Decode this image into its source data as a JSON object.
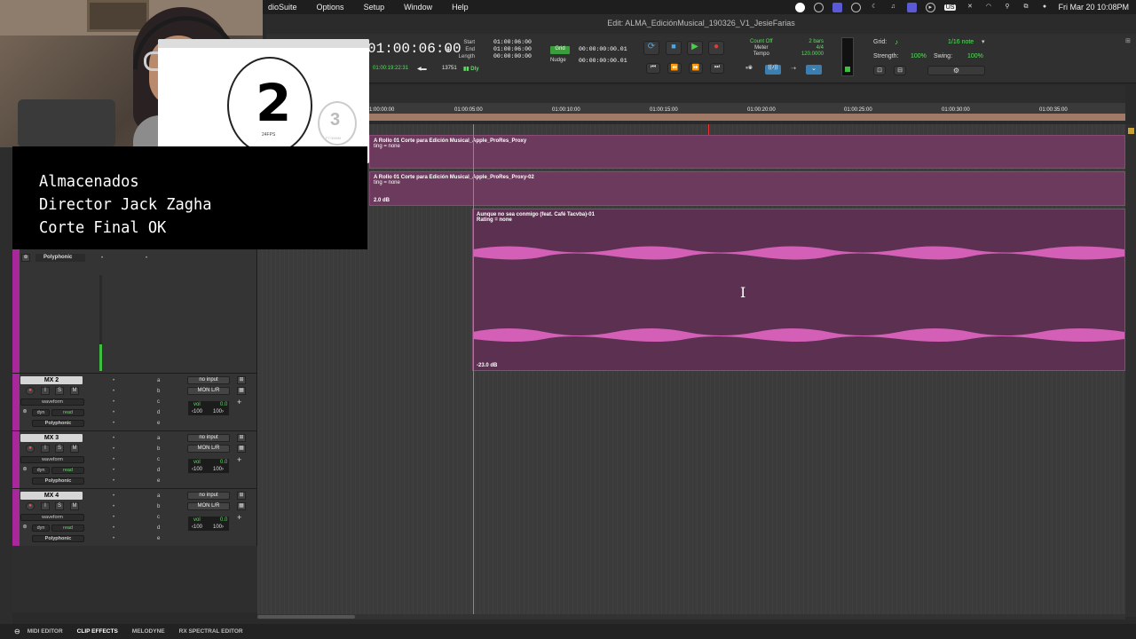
{
  "menu": {
    "app": "dioSuite",
    "items": [
      "Options",
      "Setup",
      "Window",
      "Help"
    ],
    "clock": "Fri Mar 20  10:08PM",
    "keyboard": "US"
  },
  "window": {
    "title": "Edit: ALMA_EdiciónMusical_190326_V1_JesieFarias"
  },
  "counter": {
    "main": "01:00:06:00",
    "sub": "01:00:19:22:31",
    "samples": "13751",
    "dly": "Dly"
  },
  "selection": {
    "start_label": "Start",
    "end_label": "End",
    "length_label": "Length",
    "start": "01:00:06:00",
    "end": "01:00:06:00",
    "length": "00:00:00:00"
  },
  "grid_nudge": {
    "grid_label": "Grid",
    "nudge_label": "Nudge",
    "grid_val": "00:00:00:00.01",
    "nudge_val": "00:00:00:00.01"
  },
  "count": {
    "count_off": "Count Off",
    "meter": "Meter",
    "tempo": "Tempo",
    "bars": "2 bars",
    "sig": "4/4",
    "bpm": "120.0000"
  },
  "gridpanel": {
    "grid_label": "Grid:",
    "grid_val": "1/16 note",
    "strength_label": "Strength:",
    "strength_val": "100%",
    "swing_label": "Swing:",
    "swing_val": "100%"
  },
  "ruler": {
    "ticks": [
      "1:00:00:00",
      "01:00:05:00",
      "01:00:10:00",
      "01:00:15:00",
      "01:00:20:00",
      "01:00:25:00",
      "01:00:30:00",
      "01:00:35:00"
    ]
  },
  "clips": {
    "video1_name": "A Rollo 01 Corte para Edición Musical_Apple_ProRes_Proxy",
    "video1_rating": "ting = none",
    "video2_name": "A Rollo 01 Corte para Edición Musical_Apple_ProRes_Proxy-02",
    "video2_rating": "ting = none",
    "video2_db": "2.0 dB",
    "audio_name": "Aunque no sea conmigo (feat. Café Tacvba)-01",
    "audio_rating": "Rating = none",
    "audio_db": "-23.0 dB"
  },
  "tracks": [
    {
      "name": "MX 2",
      "mode": "waveform",
      "dyn": "dyn",
      "read": "read",
      "voice": "Polyphonic",
      "input": "no input",
      "output": "MON L/R",
      "vol_label": "vol",
      "vol": "0.0",
      "pan_l": "‹100",
      "pan_r": "100›"
    },
    {
      "name": "MX 3",
      "mode": "waveform",
      "dyn": "dyn",
      "read": "read",
      "voice": "Polyphonic",
      "input": "no input",
      "output": "MON L/R",
      "vol_label": "vol",
      "vol": "0.0",
      "pan_l": "‹100",
      "pan_r": "100›"
    },
    {
      "name": "MX 4",
      "mode": "waveform",
      "dyn": "dyn",
      "read": "read",
      "voice": "Polyphonic",
      "input": "no input",
      "output": "MON L/R",
      "vol_label": "vol",
      "vol": "0.0",
      "pan_l": "‹100",
      "pan_r": "100›"
    }
  ],
  "track1_voice": "Polyphonic",
  "sends": [
    "a",
    "b",
    "c",
    "d",
    "e"
  ],
  "credit": {
    "line1": "Almacenados",
    "line2": "Director Jack Zagha",
    "line3": "Corte Final OK"
  },
  "graphic": {
    "big": "2",
    "small": "3",
    "fps": "24FPS",
    "ftmm": "FT/35MM"
  },
  "bottom_tabs": [
    "MIDI EDITOR",
    "CLIP EFFECTS",
    "MELODYNE",
    "RX SPECTRAL EDITOR"
  ],
  "colors": {
    "clip": "#6b3a5c",
    "waveform": "#d35fb7",
    "counter_green": "#57e05e"
  },
  "icons": [
    "apple-icon",
    "play-icon",
    "stop-icon",
    "record-icon",
    "rewind-icon",
    "fast-forward-icon",
    "text-cursor-icon",
    "wifi-icon",
    "search-icon"
  ]
}
